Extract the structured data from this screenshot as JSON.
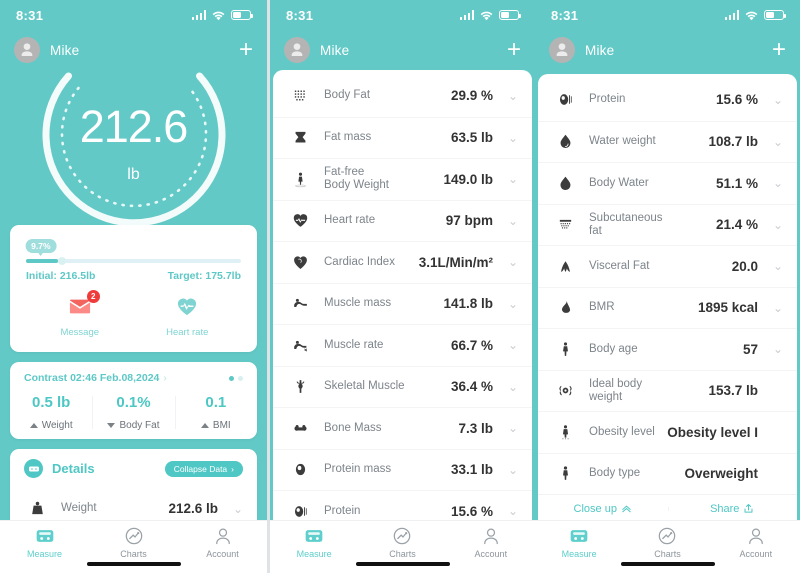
{
  "statusbar": {
    "time": "8:31"
  },
  "nav": {
    "username": "Mike",
    "add_label": "+"
  },
  "dial": {
    "value": "212.6",
    "unit": "lb"
  },
  "goal": {
    "percent": "9.7%",
    "initial": "Initial: 216.5lb",
    "target": "Target: 175.7lb",
    "shortcuts": [
      {
        "label": "Message",
        "icon": "message-icon",
        "badge": "2"
      },
      {
        "label": "Heart rate",
        "icon": "heart-rate-icon",
        "badge": ""
      }
    ]
  },
  "contrast": {
    "title": "Contrast 02:46 Feb.08,2024",
    "chevron": "›",
    "columns": [
      {
        "value": "0.5 lb",
        "label": "Weight",
        "arrow": "up"
      },
      {
        "value": "0.1%",
        "label": "Body Fat",
        "arrow": "down"
      },
      {
        "value": "0.1",
        "label": "BMI",
        "arrow": "up"
      }
    ]
  },
  "details": {
    "title": "Details",
    "icon": "scale-icon",
    "collapse_label": "Collapse Data",
    "collapse_chevron": "›",
    "rows": [
      {
        "icon": "weight-icon",
        "label": "Weight",
        "value": "212.6 lb",
        "color": "v-red",
        "chevron": true
      }
    ]
  },
  "screen2": {
    "rows": [
      {
        "icon": "body-fat-icon",
        "label": "Body Fat",
        "value": "29.9 %",
        "color": "v-red",
        "chevron": true
      },
      {
        "icon": "fat-mass-icon",
        "label": "Fat mass",
        "value": "63.5 lb",
        "color": "v-red",
        "chevron": true
      },
      {
        "icon": "fat-free-body-weight-icon",
        "label": "Fat-free\nBody Weight",
        "value": "149.0 lb",
        "color": "v-dark",
        "chevron": true
      },
      {
        "icon": "heart-rate-icon",
        "label": "Heart rate",
        "value": "97 bpm",
        "color": "v-green",
        "chevron": true
      },
      {
        "icon": "cardiac-index-icon",
        "label": "Cardiac Index",
        "value": "3.1L/Min/m²",
        "color": "v-green",
        "chevron": true
      },
      {
        "icon": "muscle-mass-icon",
        "label": "Muscle mass",
        "value": "141.8 lb",
        "color": "v-green",
        "chevron": true
      },
      {
        "icon": "muscle-rate-icon",
        "label": "Muscle rate",
        "value": "66.7 %",
        "color": "v-green",
        "chevron": true
      },
      {
        "icon": "skeletal-muscle-icon",
        "label": "Skeletal Muscle",
        "value": "36.4 %",
        "color": "v-green",
        "chevron": true
      },
      {
        "icon": "bone-mass-icon",
        "label": "Bone Mass",
        "value": "7.3 lb",
        "color": "v-blue",
        "chevron": true
      },
      {
        "icon": "protein-mass-icon",
        "label": "Protein mass",
        "value": "33.1 lb",
        "color": "v-green",
        "chevron": true
      },
      {
        "icon": "protein-icon",
        "label": "Protein",
        "value": "15.6 %",
        "color": "v-green",
        "chevron": true
      }
    ]
  },
  "screen3": {
    "rows": [
      {
        "icon": "protein-icon",
        "label": "Protein",
        "value": "15.6 %",
        "color": "v-green",
        "chevron": true
      },
      {
        "icon": "water-weight-icon",
        "label": "Water weight",
        "value": "108.7 lb",
        "color": "v-green",
        "chevron": true
      },
      {
        "icon": "body-water-icon",
        "label": "Body Water",
        "value": "51.1 %",
        "color": "v-green",
        "chevron": true
      },
      {
        "icon": "subcutaneous-fat-icon",
        "label": "Subcutaneous\nfat",
        "value": "21.4 %",
        "color": "v-red",
        "chevron": true
      },
      {
        "icon": "visceral-fat-icon",
        "label": "Visceral Fat",
        "value": "20.0",
        "color": "v-red",
        "chevron": true
      },
      {
        "icon": "bmr-icon",
        "label": "BMR",
        "value": "1895 kcal",
        "color": "v-dark",
        "chevron": true
      },
      {
        "icon": "body-age-icon",
        "label": "Body age",
        "value": "57",
        "color": "v-orange",
        "chevron": true
      },
      {
        "icon": "ideal-body-weight-icon",
        "label": "Ideal body\nweight",
        "value": "153.7 lb",
        "color": "v-dark",
        "chevron": false
      },
      {
        "icon": "obesity-level-icon",
        "label": "Obesity level",
        "value": "Obesity level I",
        "color": "v-dark",
        "chevron": false
      },
      {
        "icon": "body-type-icon",
        "label": "Body type",
        "value": "Overweight",
        "color": "v-dark",
        "chevron": false
      }
    ],
    "footer_actions": [
      {
        "label": "Close up",
        "icon": "chevron-up-icon"
      },
      {
        "label": "Share",
        "icon": "share-icon"
      }
    ]
  },
  "tabbar": {
    "tabs": [
      {
        "label": "Measure",
        "icon": "scale-icon",
        "active": true
      },
      {
        "label": "Charts",
        "icon": "chart-icon",
        "active": false
      },
      {
        "label": "Account",
        "icon": "person-icon",
        "active": false
      }
    ]
  },
  "colors": {
    "brand_teal": "#62c9c6",
    "accent_teal": "#4fc7c4",
    "red": "#f4534d",
    "green": "#3fc15a",
    "blue": "#63c5ef",
    "orange": "#f6a623",
    "badge_red": "#f03b3b"
  }
}
